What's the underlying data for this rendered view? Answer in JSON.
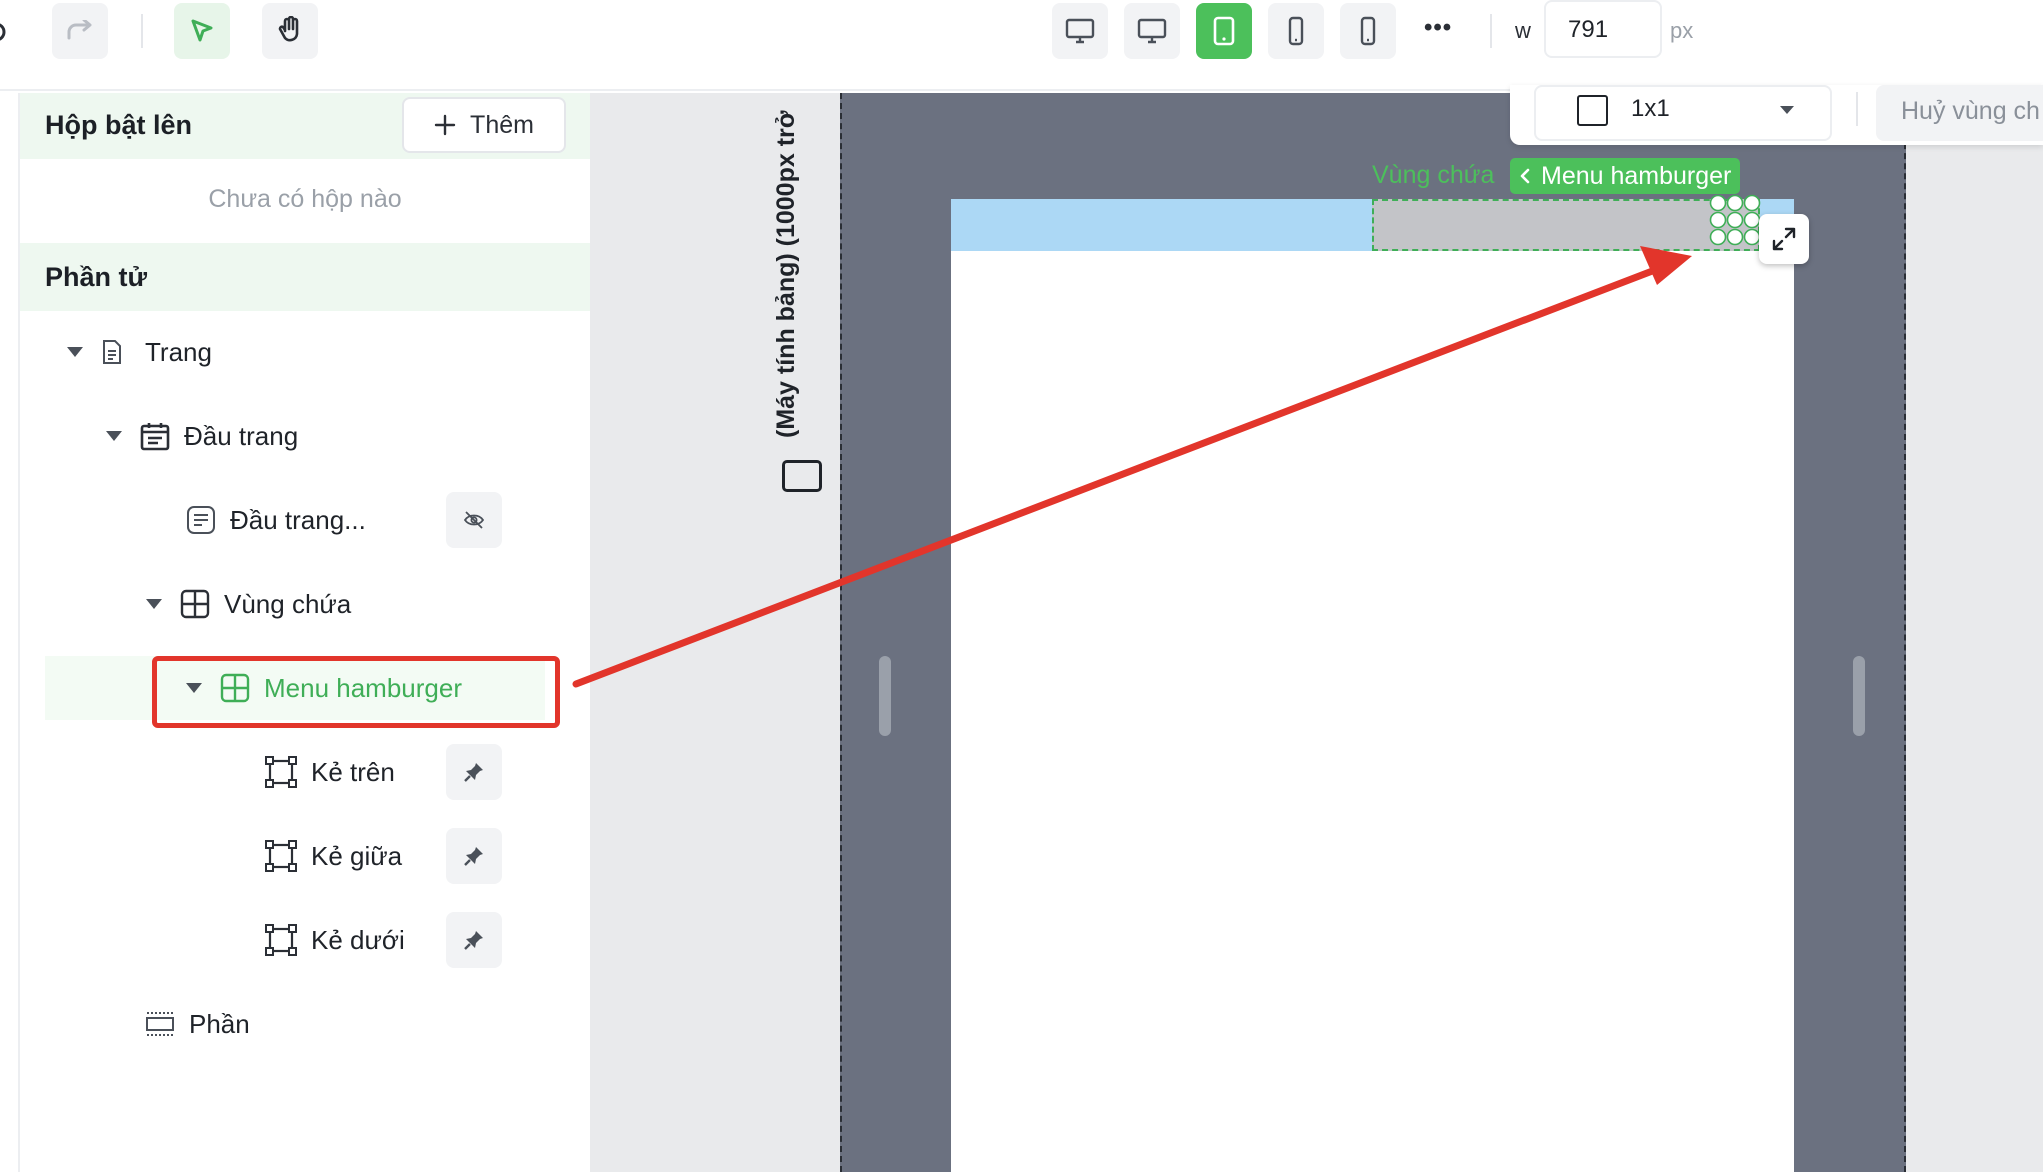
{
  "toolbar": {
    "width_label": "w",
    "width_value": "791",
    "width_unit": "px",
    "more_label": "•••"
  },
  "sidebar": {
    "popup_section": {
      "title": "Hộp bật lên",
      "add_label": "Thêm",
      "empty_text": "Chưa có hộp nào"
    },
    "elements_section": {
      "title": "Phần tử"
    },
    "tree": {
      "trang": "Trang",
      "dau_trang": "Đầu trang",
      "dau_trang_child": "Đầu trang...",
      "vung_chua": "Vùng chứa",
      "menu_hamburger": "Menu hamburger",
      "ke_tren": "Kẻ trên",
      "ke_giua": "Kẻ giữa",
      "ke_duoi": "Kẻ dưới",
      "phan": "Phần"
    }
  },
  "canvas": {
    "breakpoint_label": "(Máy tính bảng) (1000px trở",
    "breadcrumb_parent": "Vùng chứa",
    "breadcrumb_current": "Menu hamburger",
    "grid_value": "1x1",
    "cancel_label": "Huỷ vùng ch"
  },
  "colors": {
    "accent": "#4cc05b",
    "annotation": "#e2352b",
    "device_frame": "#6b7180",
    "header_strip": "#acd8f5"
  }
}
